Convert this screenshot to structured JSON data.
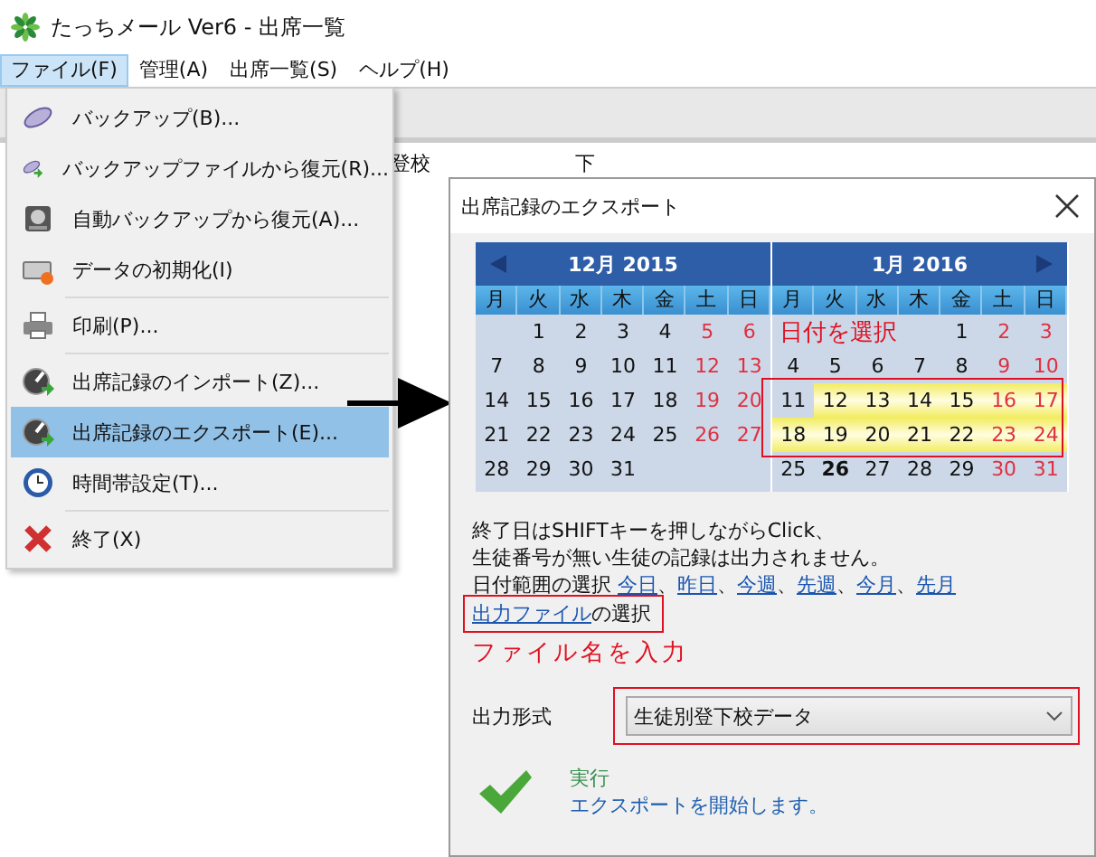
{
  "main_window": {
    "title": "たっちメール Ver6 - 出席一覧",
    "menubar": [
      {
        "label": "ファイル(F)",
        "selected": true
      },
      {
        "label": "管理(A)",
        "selected": false
      },
      {
        "label": "出席一覧(S)",
        "selected": false
      },
      {
        "label": "ヘルプ(H)",
        "selected": false
      }
    ],
    "table": {
      "columns": [
        "登校",
        "下"
      ]
    }
  },
  "file_menu": {
    "groups": [
      [
        {
          "label": "バックアップ(B)...",
          "selected": false
        },
        {
          "label": "バックアップファイルから復元(R)...",
          "selected": false
        },
        {
          "label": "自動バックアップから復元(A)...",
          "selected": false
        },
        {
          "label": "データの初期化(I)",
          "selected": false
        }
      ],
      [
        {
          "label": "印刷(P)...",
          "selected": false
        }
      ],
      [
        {
          "label": "出席記録のインポート(Z)...",
          "selected": false
        },
        {
          "label": "出席記録のエクスポート(E)...",
          "selected": true
        },
        {
          "label": "時間帯設定(T)...",
          "selected": false
        }
      ],
      [
        {
          "label": "終了(X)",
          "selected": false
        }
      ]
    ]
  },
  "dialog": {
    "title": "出席記録のエクスポート",
    "calendars": [
      {
        "month": "12月 2015",
        "weekdays": [
          "月",
          "火",
          "水",
          "木",
          "金",
          "土",
          "日"
        ],
        "weeks": [
          {
            "kind": "first",
            "days": [
              {
                "day": "1",
                "selected": false,
                "today": false
              },
              {
                "day": "2",
                "selected": false,
                "today": false
              },
              {
                "day": "3",
                "selected": false,
                "today": false
              },
              {
                "day": "4",
                "selected": false,
                "today": false
              },
              {
                "day": "5",
                "selected": false,
                "today": false
              },
              {
                "day": "6",
                "selected": false,
                "today": false
              }
            ]
          },
          {
            "kind": "full",
            "days": [
              {
                "day": "7",
                "selected": false,
                "today": false
              },
              {
                "day": "8",
                "selected": false,
                "today": false
              },
              {
                "day": "9",
                "selected": false,
                "today": false
              },
              {
                "day": "10",
                "selected": false,
                "today": false
              },
              {
                "day": "11",
                "selected": false,
                "today": false
              },
              {
                "day": "12",
                "selected": false,
                "today": false
              },
              {
                "day": "13",
                "selected": false,
                "today": false
              }
            ]
          },
          {
            "kind": "full",
            "days": [
              {
                "day": "14",
                "selected": false,
                "today": false
              },
              {
                "day": "15",
                "selected": false,
                "today": false
              },
              {
                "day": "16",
                "selected": false,
                "today": false
              },
              {
                "day": "17",
                "selected": false,
                "today": false
              },
              {
                "day": "18",
                "selected": false,
                "today": false
              },
              {
                "day": "19",
                "selected": false,
                "today": false
              },
              {
                "day": "20",
                "selected": false,
                "today": false
              }
            ]
          },
          {
            "kind": "full",
            "days": [
              {
                "day": "21",
                "selected": false,
                "today": false
              },
              {
                "day": "22",
                "selected": false,
                "today": false
              },
              {
                "day": "23",
                "selected": false,
                "today": false
              },
              {
                "day": "24",
                "selected": false,
                "today": false
              },
              {
                "day": "25",
                "selected": false,
                "today": false
              },
              {
                "day": "26",
                "selected": false,
                "today": false
              },
              {
                "day": "27",
                "selected": false,
                "today": false
              }
            ]
          },
          {
            "kind": "last",
            "days": [
              {
                "day": "28",
                "selected": false,
                "today": false
              },
              {
                "day": "29",
                "selected": false,
                "today": false
              },
              {
                "day": "30",
                "selected": false,
                "today": false
              },
              {
                "day": "31",
                "selected": false,
                "today": false
              }
            ]
          }
        ]
      },
      {
        "month": "1月 2016",
        "weekdays": [
          "月",
          "火",
          "水",
          "木",
          "金",
          "土",
          "日"
        ],
        "weeks": [
          {
            "kind": "first",
            "days": [
              {
                "day": "1",
                "selected": false,
                "today": false
              },
              {
                "day": "2",
                "selected": false,
                "today": false
              },
              {
                "day": "3",
                "selected": false,
                "today": false
              }
            ]
          },
          {
            "kind": "full",
            "days": [
              {
                "day": "4",
                "selected": false,
                "today": false
              },
              {
                "day": "5",
                "selected": false,
                "today": false
              },
              {
                "day": "6",
                "selected": false,
                "today": false
              },
              {
                "day": "7",
                "selected": false,
                "today": false
              },
              {
                "day": "8",
                "selected": false,
                "today": false
              },
              {
                "day": "9",
                "selected": false,
                "today": false
              },
              {
                "day": "10",
                "selected": false,
                "today": false
              }
            ]
          },
          {
            "kind": "full",
            "days": [
              {
                "day": "11",
                "selected": false,
                "today": false
              },
              {
                "day": "12",
                "selected": true,
                "today": false
              },
              {
                "day": "13",
                "selected": true,
                "today": false
              },
              {
                "day": "14",
                "selected": true,
                "today": false
              },
              {
                "day": "15",
                "selected": true,
                "today": false
              },
              {
                "day": "16",
                "selected": true,
                "today": false
              },
              {
                "day": "17",
                "selected": true,
                "today": false
              }
            ]
          },
          {
            "kind": "full",
            "days": [
              {
                "day": "18",
                "selected": true,
                "today": false
              },
              {
                "day": "19",
                "selected": true,
                "today": false
              },
              {
                "day": "20",
                "selected": true,
                "today": false
              },
              {
                "day": "21",
                "selected": true,
                "today": false
              },
              {
                "day": "22",
                "selected": true,
                "today": false
              },
              {
                "day": "23",
                "selected": true,
                "today": false
              },
              {
                "day": "24",
                "selected": true,
                "today": false
              }
            ]
          },
          {
            "kind": "full",
            "days": [
              {
                "day": "25",
                "selected": false,
                "today": false
              },
              {
                "day": "26",
                "selected": false,
                "today": true
              },
              {
                "day": "27",
                "selected": false,
                "today": false
              },
              {
                "day": "28",
                "selected": false,
                "today": false
              },
              {
                "day": "29",
                "selected": false,
                "today": false
              },
              {
                "day": "30",
                "selected": false,
                "today": false
              },
              {
                "day": "31",
                "selected": false,
                "today": false
              }
            ]
          }
        ]
      }
    ],
    "date_annotation": "日付を選択",
    "notes": [
      "終了日はSHIFTキーを押しながらClick、",
      "生徒番号が無い生徒の記録は出力されません。"
    ],
    "date_range": {
      "label": "日付範囲の選択",
      "links": [
        "今日",
        "昨日",
        "今週",
        "先週",
        "今月",
        "先月"
      ],
      "separator": "、"
    },
    "output_file": {
      "link": "出力ファイル",
      "text": "の選択"
    },
    "file_annotation": "ファイル名を入力",
    "output_format": {
      "label": "出力形式",
      "value": "生徒別登下校データ"
    },
    "execute": {
      "title": "実行",
      "description": "エクスポートを開始します。"
    }
  }
}
